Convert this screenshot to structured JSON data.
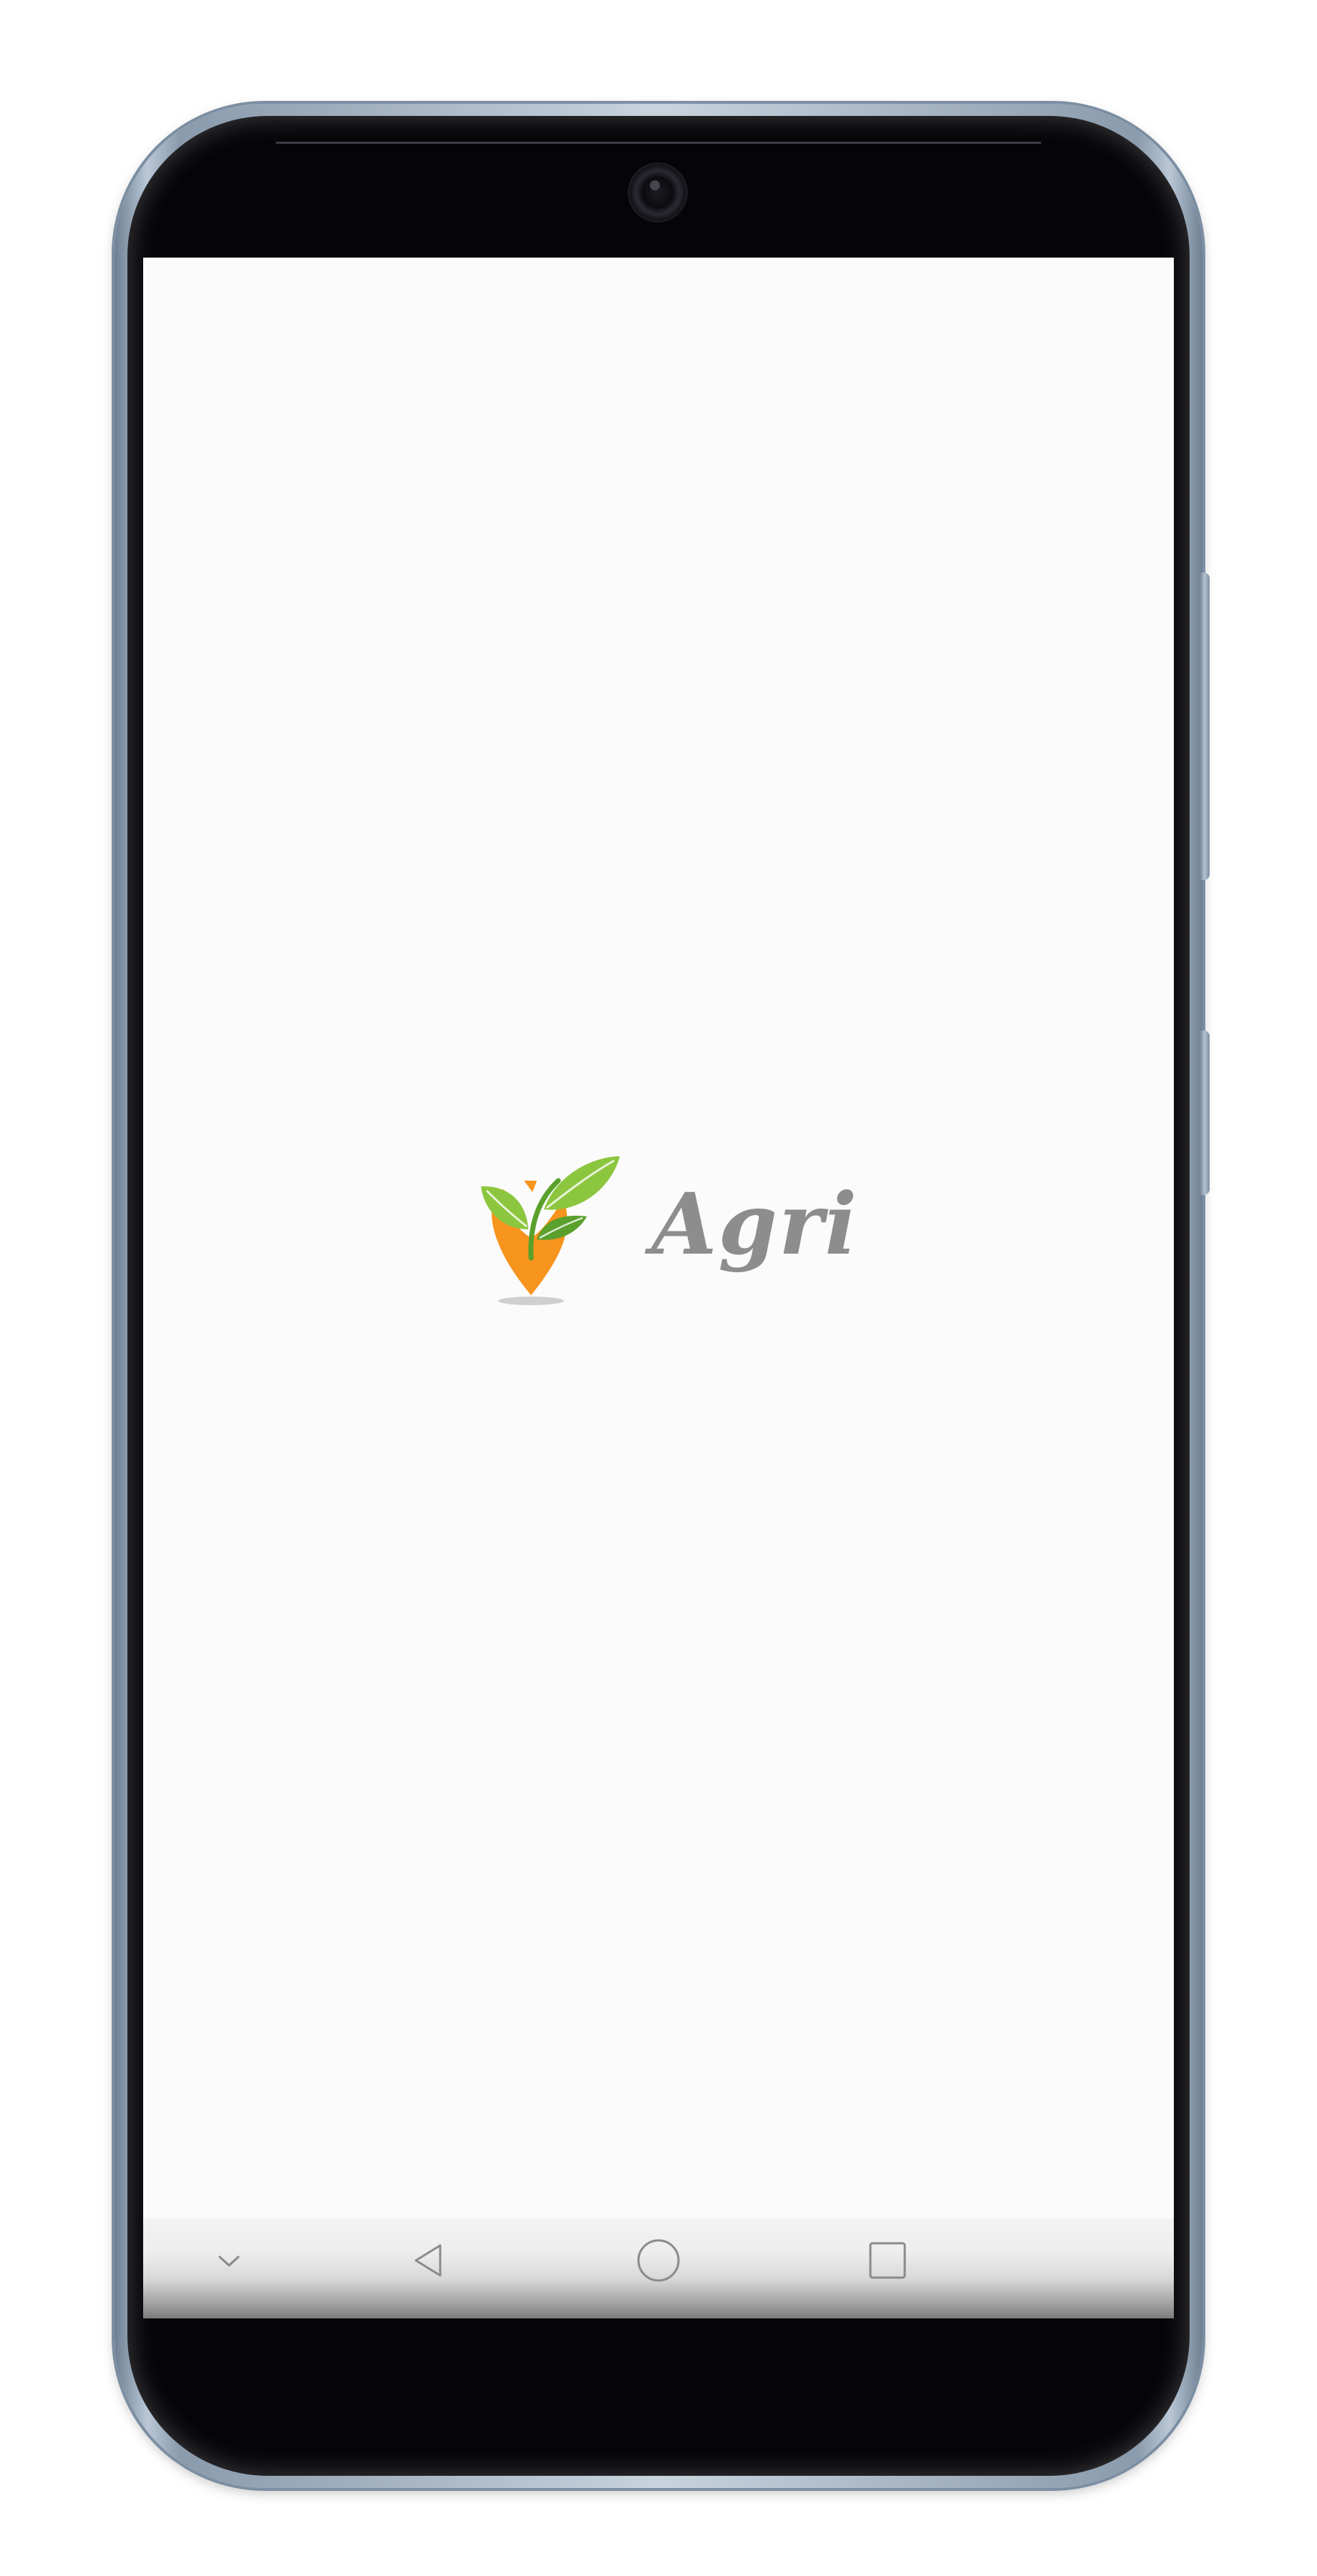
{
  "app": {
    "name": "Agri"
  },
  "splash": {
    "wordmark": "Agri",
    "brand_colors": {
      "leaf_light": "#8cc63f",
      "leaf_dark": "#5aa02c",
      "pin_orange": "#f7941d",
      "wordmark_gray": "#8d8d8d"
    }
  },
  "navigation": {
    "buttons": [
      {
        "icon": "chevron-down-icon",
        "action": "collapse"
      },
      {
        "icon": "back-triangle-icon",
        "action": "back"
      },
      {
        "icon": "home-circle-icon",
        "action": "home"
      },
      {
        "icon": "recent-apps-square-icon",
        "action": "recents"
      }
    ]
  }
}
